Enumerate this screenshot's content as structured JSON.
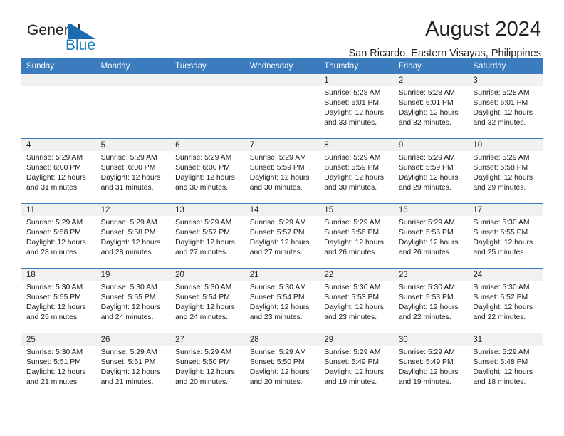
{
  "brand": {
    "name_part1": "General",
    "name_part2": "Blue",
    "flag_color": "#1a6bb0",
    "text_color": "#1a7fc1"
  },
  "header": {
    "title": "August 2024",
    "subtitle": "San Ricardo, Eastern Visayas, Philippines",
    "accent_color": "#3a7cbe"
  },
  "weekdays": [
    "Sunday",
    "Monday",
    "Tuesday",
    "Wednesday",
    "Thursday",
    "Friday",
    "Saturday"
  ],
  "labels": {
    "sunrise": "Sunrise:",
    "sunset": "Sunset:",
    "daylight": "Daylight:"
  },
  "weeks": [
    [
      {
        "day": "",
        "sunrise": "",
        "sunset": "",
        "daylight_line1": "",
        "daylight_line2": ""
      },
      {
        "day": "",
        "sunrise": "",
        "sunset": "",
        "daylight_line1": "",
        "daylight_line2": ""
      },
      {
        "day": "",
        "sunrise": "",
        "sunset": "",
        "daylight_line1": "",
        "daylight_line2": ""
      },
      {
        "day": "",
        "sunrise": "",
        "sunset": "",
        "daylight_line1": "",
        "daylight_line2": ""
      },
      {
        "day": "1",
        "sunrise": "Sunrise: 5:28 AM",
        "sunset": "Sunset: 6:01 PM",
        "daylight_line1": "Daylight: 12 hours",
        "daylight_line2": "and 33 minutes."
      },
      {
        "day": "2",
        "sunrise": "Sunrise: 5:28 AM",
        "sunset": "Sunset: 6:01 PM",
        "daylight_line1": "Daylight: 12 hours",
        "daylight_line2": "and 32 minutes."
      },
      {
        "day": "3",
        "sunrise": "Sunrise: 5:28 AM",
        "sunset": "Sunset: 6:01 PM",
        "daylight_line1": "Daylight: 12 hours",
        "daylight_line2": "and 32 minutes."
      }
    ],
    [
      {
        "day": "4",
        "sunrise": "Sunrise: 5:29 AM",
        "sunset": "Sunset: 6:00 PM",
        "daylight_line1": "Daylight: 12 hours",
        "daylight_line2": "and 31 minutes."
      },
      {
        "day": "5",
        "sunrise": "Sunrise: 5:29 AM",
        "sunset": "Sunset: 6:00 PM",
        "daylight_line1": "Daylight: 12 hours",
        "daylight_line2": "and 31 minutes."
      },
      {
        "day": "6",
        "sunrise": "Sunrise: 5:29 AM",
        "sunset": "Sunset: 6:00 PM",
        "daylight_line1": "Daylight: 12 hours",
        "daylight_line2": "and 30 minutes."
      },
      {
        "day": "7",
        "sunrise": "Sunrise: 5:29 AM",
        "sunset": "Sunset: 5:59 PM",
        "daylight_line1": "Daylight: 12 hours",
        "daylight_line2": "and 30 minutes."
      },
      {
        "day": "8",
        "sunrise": "Sunrise: 5:29 AM",
        "sunset": "Sunset: 5:59 PM",
        "daylight_line1": "Daylight: 12 hours",
        "daylight_line2": "and 30 minutes."
      },
      {
        "day": "9",
        "sunrise": "Sunrise: 5:29 AM",
        "sunset": "Sunset: 5:59 PM",
        "daylight_line1": "Daylight: 12 hours",
        "daylight_line2": "and 29 minutes."
      },
      {
        "day": "10",
        "sunrise": "Sunrise: 5:29 AM",
        "sunset": "Sunset: 5:58 PM",
        "daylight_line1": "Daylight: 12 hours",
        "daylight_line2": "and 29 minutes."
      }
    ],
    [
      {
        "day": "11",
        "sunrise": "Sunrise: 5:29 AM",
        "sunset": "Sunset: 5:58 PM",
        "daylight_line1": "Daylight: 12 hours",
        "daylight_line2": "and 28 minutes."
      },
      {
        "day": "12",
        "sunrise": "Sunrise: 5:29 AM",
        "sunset": "Sunset: 5:58 PM",
        "daylight_line1": "Daylight: 12 hours",
        "daylight_line2": "and 28 minutes."
      },
      {
        "day": "13",
        "sunrise": "Sunrise: 5:29 AM",
        "sunset": "Sunset: 5:57 PM",
        "daylight_line1": "Daylight: 12 hours",
        "daylight_line2": "and 27 minutes."
      },
      {
        "day": "14",
        "sunrise": "Sunrise: 5:29 AM",
        "sunset": "Sunset: 5:57 PM",
        "daylight_line1": "Daylight: 12 hours",
        "daylight_line2": "and 27 minutes."
      },
      {
        "day": "15",
        "sunrise": "Sunrise: 5:29 AM",
        "sunset": "Sunset: 5:56 PM",
        "daylight_line1": "Daylight: 12 hours",
        "daylight_line2": "and 26 minutes."
      },
      {
        "day": "16",
        "sunrise": "Sunrise: 5:29 AM",
        "sunset": "Sunset: 5:56 PM",
        "daylight_line1": "Daylight: 12 hours",
        "daylight_line2": "and 26 minutes."
      },
      {
        "day": "17",
        "sunrise": "Sunrise: 5:30 AM",
        "sunset": "Sunset: 5:55 PM",
        "daylight_line1": "Daylight: 12 hours",
        "daylight_line2": "and 25 minutes."
      }
    ],
    [
      {
        "day": "18",
        "sunrise": "Sunrise: 5:30 AM",
        "sunset": "Sunset: 5:55 PM",
        "daylight_line1": "Daylight: 12 hours",
        "daylight_line2": "and 25 minutes."
      },
      {
        "day": "19",
        "sunrise": "Sunrise: 5:30 AM",
        "sunset": "Sunset: 5:55 PM",
        "daylight_line1": "Daylight: 12 hours",
        "daylight_line2": "and 24 minutes."
      },
      {
        "day": "20",
        "sunrise": "Sunrise: 5:30 AM",
        "sunset": "Sunset: 5:54 PM",
        "daylight_line1": "Daylight: 12 hours",
        "daylight_line2": "and 24 minutes."
      },
      {
        "day": "21",
        "sunrise": "Sunrise: 5:30 AM",
        "sunset": "Sunset: 5:54 PM",
        "daylight_line1": "Daylight: 12 hours",
        "daylight_line2": "and 23 minutes."
      },
      {
        "day": "22",
        "sunrise": "Sunrise: 5:30 AM",
        "sunset": "Sunset: 5:53 PM",
        "daylight_line1": "Daylight: 12 hours",
        "daylight_line2": "and 23 minutes."
      },
      {
        "day": "23",
        "sunrise": "Sunrise: 5:30 AM",
        "sunset": "Sunset: 5:53 PM",
        "daylight_line1": "Daylight: 12 hours",
        "daylight_line2": "and 22 minutes."
      },
      {
        "day": "24",
        "sunrise": "Sunrise: 5:30 AM",
        "sunset": "Sunset: 5:52 PM",
        "daylight_line1": "Daylight: 12 hours",
        "daylight_line2": "and 22 minutes."
      }
    ],
    [
      {
        "day": "25",
        "sunrise": "Sunrise: 5:30 AM",
        "sunset": "Sunset: 5:51 PM",
        "daylight_line1": "Daylight: 12 hours",
        "daylight_line2": "and 21 minutes."
      },
      {
        "day": "26",
        "sunrise": "Sunrise: 5:29 AM",
        "sunset": "Sunset: 5:51 PM",
        "daylight_line1": "Daylight: 12 hours",
        "daylight_line2": "and 21 minutes."
      },
      {
        "day": "27",
        "sunrise": "Sunrise: 5:29 AM",
        "sunset": "Sunset: 5:50 PM",
        "daylight_line1": "Daylight: 12 hours",
        "daylight_line2": "and 20 minutes."
      },
      {
        "day": "28",
        "sunrise": "Sunrise: 5:29 AM",
        "sunset": "Sunset: 5:50 PM",
        "daylight_line1": "Daylight: 12 hours",
        "daylight_line2": "and 20 minutes."
      },
      {
        "day": "29",
        "sunrise": "Sunrise: 5:29 AM",
        "sunset": "Sunset: 5:49 PM",
        "daylight_line1": "Daylight: 12 hours",
        "daylight_line2": "and 19 minutes."
      },
      {
        "day": "30",
        "sunrise": "Sunrise: 5:29 AM",
        "sunset": "Sunset: 5:49 PM",
        "daylight_line1": "Daylight: 12 hours",
        "daylight_line2": "and 19 minutes."
      },
      {
        "day": "31",
        "sunrise": "Sunrise: 5:29 AM",
        "sunset": "Sunset: 5:48 PM",
        "daylight_line1": "Daylight: 12 hours",
        "daylight_line2": "and 18 minutes."
      }
    ]
  ]
}
